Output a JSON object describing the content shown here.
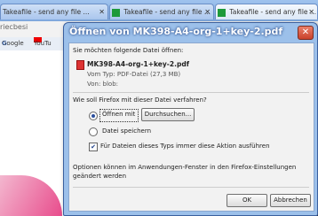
{
  "browser": {
    "tabs": [
      {
        "label": "Takeafile - send any file ..."
      },
      {
        "label": "Takeafile - send any file ..."
      },
      {
        "label": "Takeafile - send any file ..."
      }
    ],
    "url_fragment": "riecbesi",
    "bookmarks": [
      "Google",
      "YouTu"
    ]
  },
  "dialog": {
    "title": "Öffnen von MK398-A4-org-1+key-2.pdf",
    "close_glyph": "✕",
    "intro": "Sie möchten folgende Datei öffnen:",
    "file_name": "MK398-A4-org-1+key-2.pdf",
    "file_type": "Vom Typ: PDF-Datei (27,3 MB)",
    "file_source": "Von: blob:",
    "question": "Wie soll Firefox mit dieser Datei verfahren?",
    "open_with_label": "Öffnen mit",
    "browse_button": "Durchsuchen...",
    "save_label": "Datei speichern",
    "remember_label": "Für Dateien dieses Typs immer diese Aktion ausführen",
    "remember_checked": true,
    "info_line1": "Optionen können im Anwendungen-Fenster in den Firefox-Einstellungen",
    "info_line2": "geändert werden",
    "ok_button": "OK",
    "cancel_button": "Abbrechen"
  }
}
